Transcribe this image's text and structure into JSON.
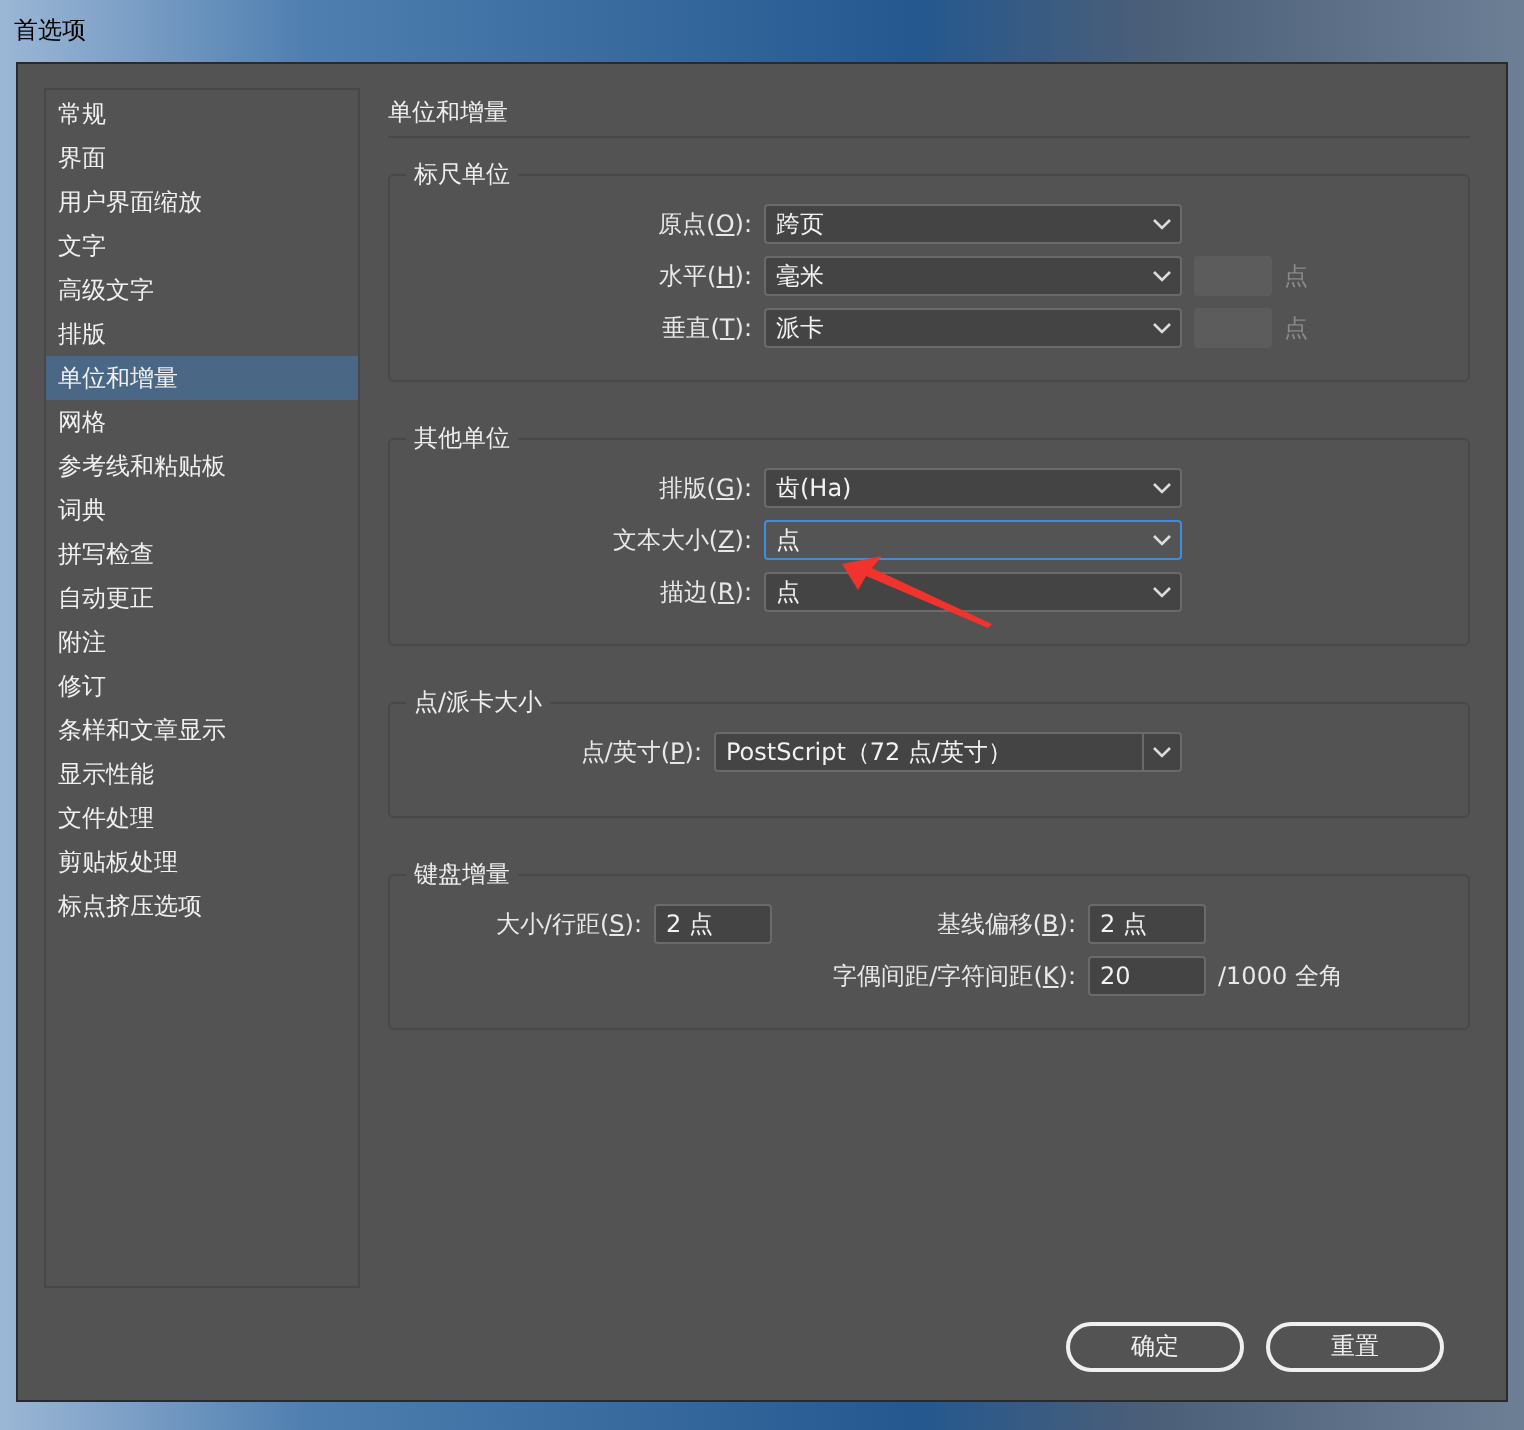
{
  "window": {
    "title": "首选项"
  },
  "sidebar": {
    "items": [
      {
        "label": "常规",
        "selected": false
      },
      {
        "label": "界面",
        "selected": false
      },
      {
        "label": "用户界面缩放",
        "selected": false
      },
      {
        "label": "文字",
        "selected": false
      },
      {
        "label": "高级文字",
        "selected": false
      },
      {
        "label": "排版",
        "selected": false
      },
      {
        "label": "单位和增量",
        "selected": true
      },
      {
        "label": "网格",
        "selected": false
      },
      {
        "label": "参考线和粘贴板",
        "selected": false
      },
      {
        "label": "词典",
        "selected": false
      },
      {
        "label": "拼写检查",
        "selected": false
      },
      {
        "label": "自动更正",
        "selected": false
      },
      {
        "label": "附注",
        "selected": false
      },
      {
        "label": "修订",
        "selected": false
      },
      {
        "label": "条样和文章显示",
        "selected": false
      },
      {
        "label": "显示性能",
        "selected": false
      },
      {
        "label": "文件处理",
        "selected": false
      },
      {
        "label": "剪贴板处理",
        "selected": false
      },
      {
        "label": "标点挤压选项",
        "selected": false
      }
    ]
  },
  "panel": {
    "heading": "单位和增量",
    "groups": [
      {
        "legend": "标尺单位",
        "kind": "selects",
        "rows": [
          {
            "label": "原点(",
            "mnemonic": "O",
            "label_tail": "):",
            "value": "跨页",
            "focused": false
          },
          {
            "label": "水平(",
            "mnemonic": "H",
            "label_tail": "):",
            "value": "毫米",
            "focused": false,
            "side_field": {
              "disabled": true
            },
            "side_unit": "点"
          },
          {
            "label": "垂直(",
            "mnemonic": "T",
            "label_tail": "):",
            "value": "派卡",
            "focused": false,
            "side_field": {
              "disabled": true
            },
            "side_unit": "点"
          }
        ]
      },
      {
        "legend": "其他单位",
        "kind": "selects",
        "rows": [
          {
            "label": "排版(",
            "mnemonic": "G",
            "label_tail": "):",
            "value": "齿(Ha)",
            "focused": false
          },
          {
            "label": "文本大小(",
            "mnemonic": "Z",
            "label_tail": "):",
            "value": "点",
            "focused": true
          },
          {
            "label": "描边(",
            "mnemonic": "R",
            "label_tail": "):",
            "value": "点",
            "focused": false
          }
        ]
      },
      {
        "legend": "点/派卡大小",
        "kind": "combo",
        "rows": [
          {
            "label": "点/英寸(",
            "mnemonic": "P",
            "label_tail": "):",
            "value": "PostScript（72 点/英寸）",
            "focused": false
          }
        ]
      },
      {
        "legend": "键盘增量",
        "kind": "fields",
        "rows": [
          {
            "left": {
              "label": "大小/行距(",
              "mnemonic": "S",
              "label_tail": "):",
              "value": "2 点"
            },
            "right": {
              "label": "基线偏移(",
              "mnemonic": "B",
              "label_tail": "):",
              "value": "2 点"
            }
          },
          {
            "right": {
              "label": "字偶间距/字符间距(",
              "mnemonic": "K",
              "label_tail": "):",
              "value": "20",
              "suffix": "/1000 全角"
            }
          }
        ]
      }
    ]
  },
  "buttons": [
    {
      "label": "确定"
    },
    {
      "label": "重置"
    }
  ]
}
